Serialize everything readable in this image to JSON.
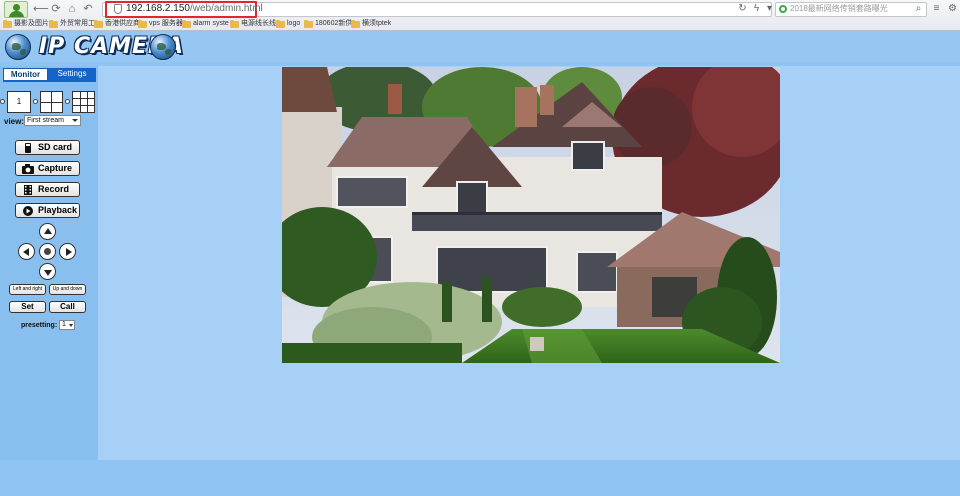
{
  "browser": {
    "address_host": "192.168.2.150",
    "address_path": "/web/admin.html",
    "search_placeholder": "2018最新网络传销套路曝光",
    "bookmarks": [
      "摄影及图片",
      "外贸常用工",
      "香港供应商",
      "vps 服务器",
      "alarm syste",
      "电源线长线",
      "logo",
      "180602新供",
      "横须tptek"
    ]
  },
  "header": {
    "title": "IP CAMERA"
  },
  "tabs": {
    "monitor": "Monitor",
    "settings": "Settings"
  },
  "layout": {
    "single_label": "1"
  },
  "view": {
    "label": "view:",
    "selected": "First stream"
  },
  "actions": {
    "sd_card": "SD card",
    "capture": "Capture",
    "record": "Record",
    "playback": "Playback"
  },
  "ptz": {
    "left_right": "Left and right",
    "up_down": "Up and down",
    "set": "Set",
    "call": "Call",
    "preset_label": "presetting:",
    "preset_value": "1"
  },
  "colors": {
    "page_bg": "#8fc4f2",
    "tab_active": "#1565c8",
    "highlight_box": "#e2262a"
  }
}
